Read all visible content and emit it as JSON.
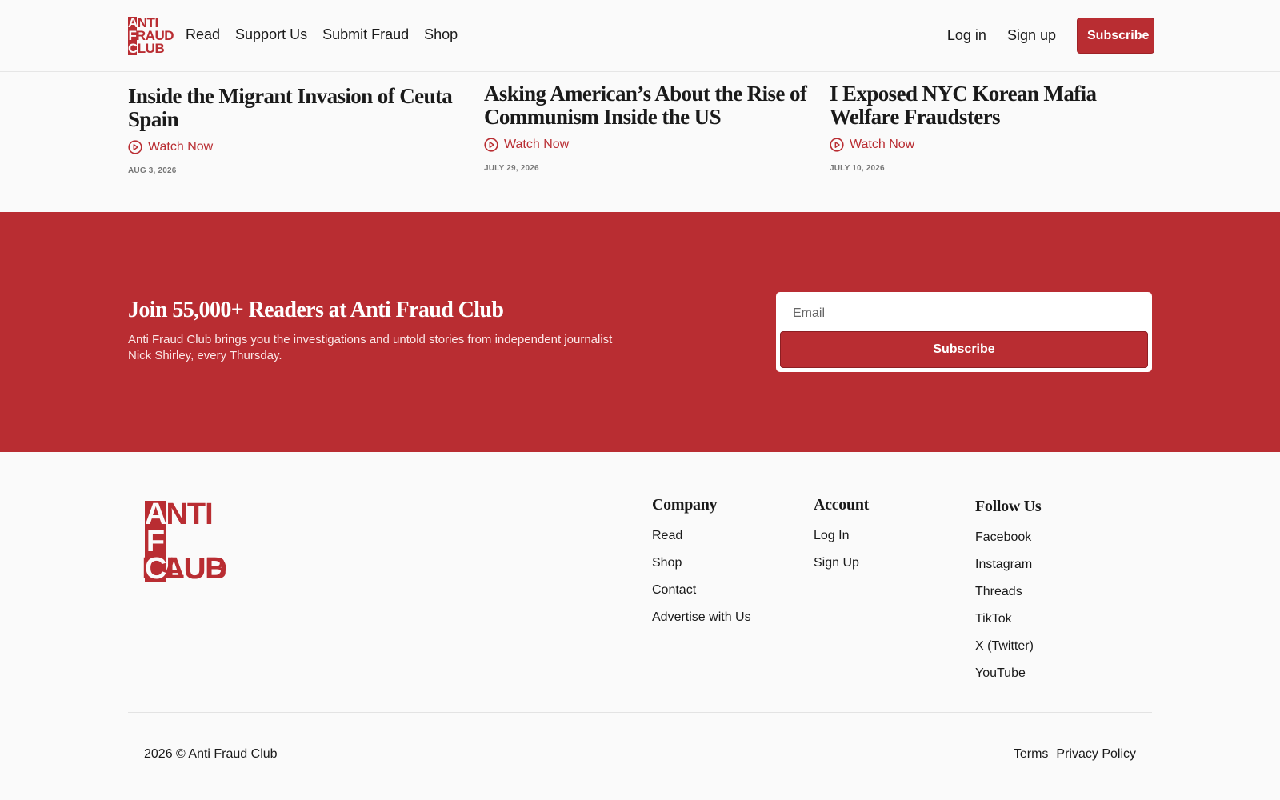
{
  "header": {
    "logo_lines": [
      "ANTI",
      "FRAUD",
      "CLUB"
    ],
    "nav": [
      "Read",
      "Support Us",
      "Submit Fraud",
      "Shop"
    ],
    "login": "Log in",
    "signup": "Sign up",
    "subscribe": "Subscribe"
  },
  "articles": [
    {
      "title": "Inside the Migrant Invasion of Ceuta Spain",
      "cta": "Watch Now",
      "date": "AUG 3, 2026"
    },
    {
      "title": "Asking American’s About the Rise of Communism Inside the US",
      "cta": "Watch Now",
      "date": "JULY 29, 2026"
    },
    {
      "title": "I Exposed NYC Korean Mafia Welfare Fraudsters",
      "cta": "Watch Now",
      "date": "JULY 10, 2026"
    }
  ],
  "newsletter": {
    "heading": "Join 55,000+ Readers at Anti Fraud Club",
    "description": "Anti Fraud Club brings you the investigations and untold stories from independent journalist Nick Shirley, every Thursday.",
    "email_placeholder": "Email",
    "button": "Subscribe"
  },
  "footer": {
    "logo_lines": [
      "ANTI",
      "FRAUD",
      "CLUB"
    ],
    "company": {
      "title": "Company",
      "links": [
        "Read",
        "Shop",
        "Contact",
        "Advertise with Us"
      ]
    },
    "account": {
      "title": "Account",
      "links": [
        "Log In",
        "Sign Up"
      ]
    },
    "follow": {
      "title": "Follow Us",
      "links": [
        "Facebook",
        "Instagram",
        "Threads",
        "TikTok",
        "X (Twitter)",
        "YouTube"
      ]
    },
    "copyright": "2026 © Anti Fraud Club",
    "legal": [
      "Terms",
      "Privacy Policy"
    ]
  },
  "colors": {
    "brand": "#b92d32",
    "background": "#fafafa",
    "text": "#1a1a1a"
  },
  "icons": {
    "watch": "play-circle-icon"
  }
}
